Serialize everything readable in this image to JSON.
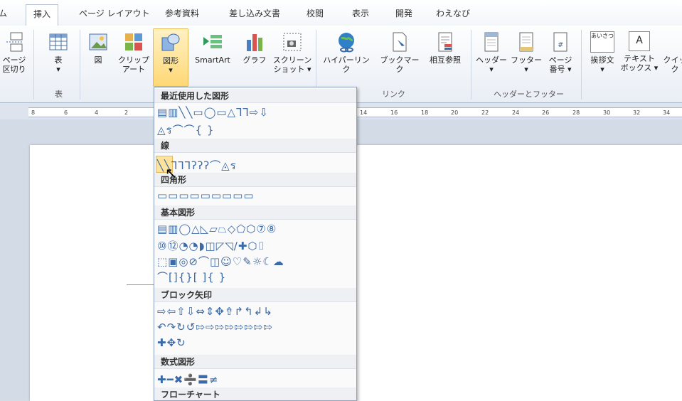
{
  "tabs": [
    "ム",
    "挿入",
    "ページ レイアウト",
    "参考資料",
    "差し込み文書",
    "校閲",
    "表示",
    "開発",
    "わえなび"
  ],
  "ribbon": {
    "page_break": [
      "ページ",
      "区切り"
    ],
    "table": "表",
    "table_arrow": "▾",
    "group_table": "表",
    "picture": "図",
    "clipart": [
      "クリップ",
      "アート"
    ],
    "shapes": "図形",
    "shapes_arrow": "▾",
    "smartart": "SmartArt",
    "graph": "グラフ",
    "screenshot": [
      "スクリーン",
      "ショット ▾"
    ],
    "hyperlink": "ハイパーリンク",
    "bookmark": "ブックマーク",
    "crossref": "相互参照",
    "group_link": "リンク",
    "header": "ヘッダー",
    "header_arrow": "▾",
    "footer": "フッター",
    "footer_arrow": "▾",
    "pagenum": [
      "ページ",
      "番号 ▾"
    ],
    "group_hf": "ヘッダーとフッター",
    "greeting": "挨拶文",
    "greeting_arrow": "▾",
    "textbox": [
      "テキスト",
      "ボックス ▾"
    ],
    "quick": "クイック",
    "greeting_icon_text": "あいさつ",
    "textbox_icon_text": "A"
  },
  "ruler": [
    "8",
    "6",
    "4",
    "2",
    "14",
    "16",
    "18",
    "20",
    "22",
    "24",
    "26",
    "28",
    "30",
    "32",
    "34"
  ],
  "dropdown": {
    "sections": [
      "最近使用した図形",
      "線",
      "四角形",
      "基本図形",
      "ブロック矢印",
      "数式図形",
      "フローチャート"
    ],
    "rows": {
      "recent1": "▤▥╲╲▭◯▭△⅂⅂⇨⇩",
      "recent2": "◬ร⌒⌒{ }",
      "lines": "╲╲⅂⅂⅂ʔʔʔ⌒◬ร",
      "rects": "▭▭▭▭▭▭▭▭▭",
      "basic1": "▤▥◯△◺▱⏢◇⬠⬡⑦⑧",
      "basic2": "⑩⑫◔◔◗◫◸◹∕✚⬡⌷",
      "basic3": "⬚▣◎⊘⌒◫☺♡✎☼☾☁",
      "basic4": "⌒[]{}[ ]{ }",
      "arrows1": "⇨⇦⇧⇩⇔⇕✥⇮↱↰↲↳",
      "arrows2": "↶↷↻↺⇰⇨⇰⇰⇰⇰⇰⇰",
      "arrows3": "✚✥↻",
      "math": "✚━✖➗〓≠"
    }
  }
}
